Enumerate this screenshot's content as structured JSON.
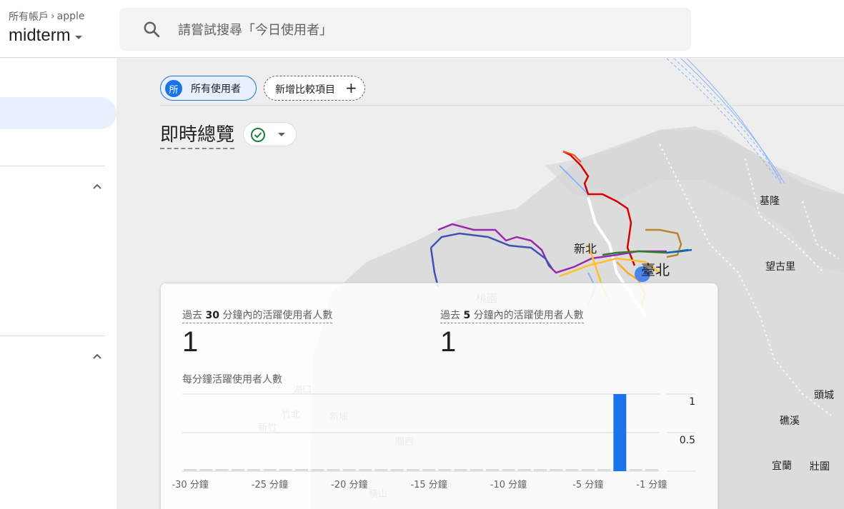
{
  "header": {
    "account_crumb": "所有帳戶",
    "account_name": "apple",
    "property_name": "midterm",
    "search_placeholder": "請嘗試搜尋「今日使用者」"
  },
  "comparison": {
    "avatar_letter": "所",
    "segment_label": "所有使用者",
    "add_label": "新增比較項目"
  },
  "page": {
    "title": "即時總覽"
  },
  "map_labels": {
    "keelung": "基隆",
    "wangguli": "望古里",
    "newtaipei": "新北",
    "taipei": "臺北",
    "taoyuan": "桃園",
    "hukou": "湖口",
    "zhubei": "竹北",
    "xinpu": "新埔",
    "hsinchu": "新竹",
    "guanxi": "關西",
    "hengshan": "橫山",
    "toucheng": "頭城",
    "jiaoxi": "礁溪",
    "yilan": "宜蘭",
    "zhuangwei": "壯圍"
  },
  "card": {
    "metric1_pre": "過去 ",
    "metric1_num": "30",
    "metric1_post": " 分鐘內的活躍使用者人數",
    "metric1_value": "1",
    "metric2_pre": "過去 ",
    "metric2_num": "5",
    "metric2_post": " 分鐘內的活躍使用者人數",
    "metric2_value": "1",
    "chart_title": "每分鐘活躍使用者人數"
  },
  "chart_data": {
    "type": "bar",
    "categories": [
      -30,
      -29,
      -28,
      -27,
      -26,
      -25,
      -24,
      -23,
      -22,
      -21,
      -20,
      -19,
      -18,
      -17,
      -16,
      -15,
      -14,
      -13,
      -12,
      -11,
      -10,
      -9,
      -8,
      -7,
      -6,
      -5,
      -4,
      -3,
      -2,
      -1
    ],
    "values": [
      0,
      0,
      0,
      0,
      0,
      0,
      0,
      0,
      0,
      0,
      0,
      0,
      0,
      0,
      0,
      0,
      0,
      0,
      0,
      0,
      0,
      0,
      0,
      0,
      0,
      0,
      0,
      1,
      0,
      0
    ],
    "x_tick_labels": [
      "-30 分鐘",
      "-25 分鐘",
      "-20 分鐘",
      "-15 分鐘",
      "-10 分鐘",
      "-5 分鐘",
      "-1 分鐘"
    ],
    "y_tick_labels": [
      "1",
      "0.5"
    ],
    "ylim": [
      0,
      1
    ],
    "bar_color": "#1a73e8",
    "empty_bar_color": "#dadce0",
    "grid": true
  }
}
